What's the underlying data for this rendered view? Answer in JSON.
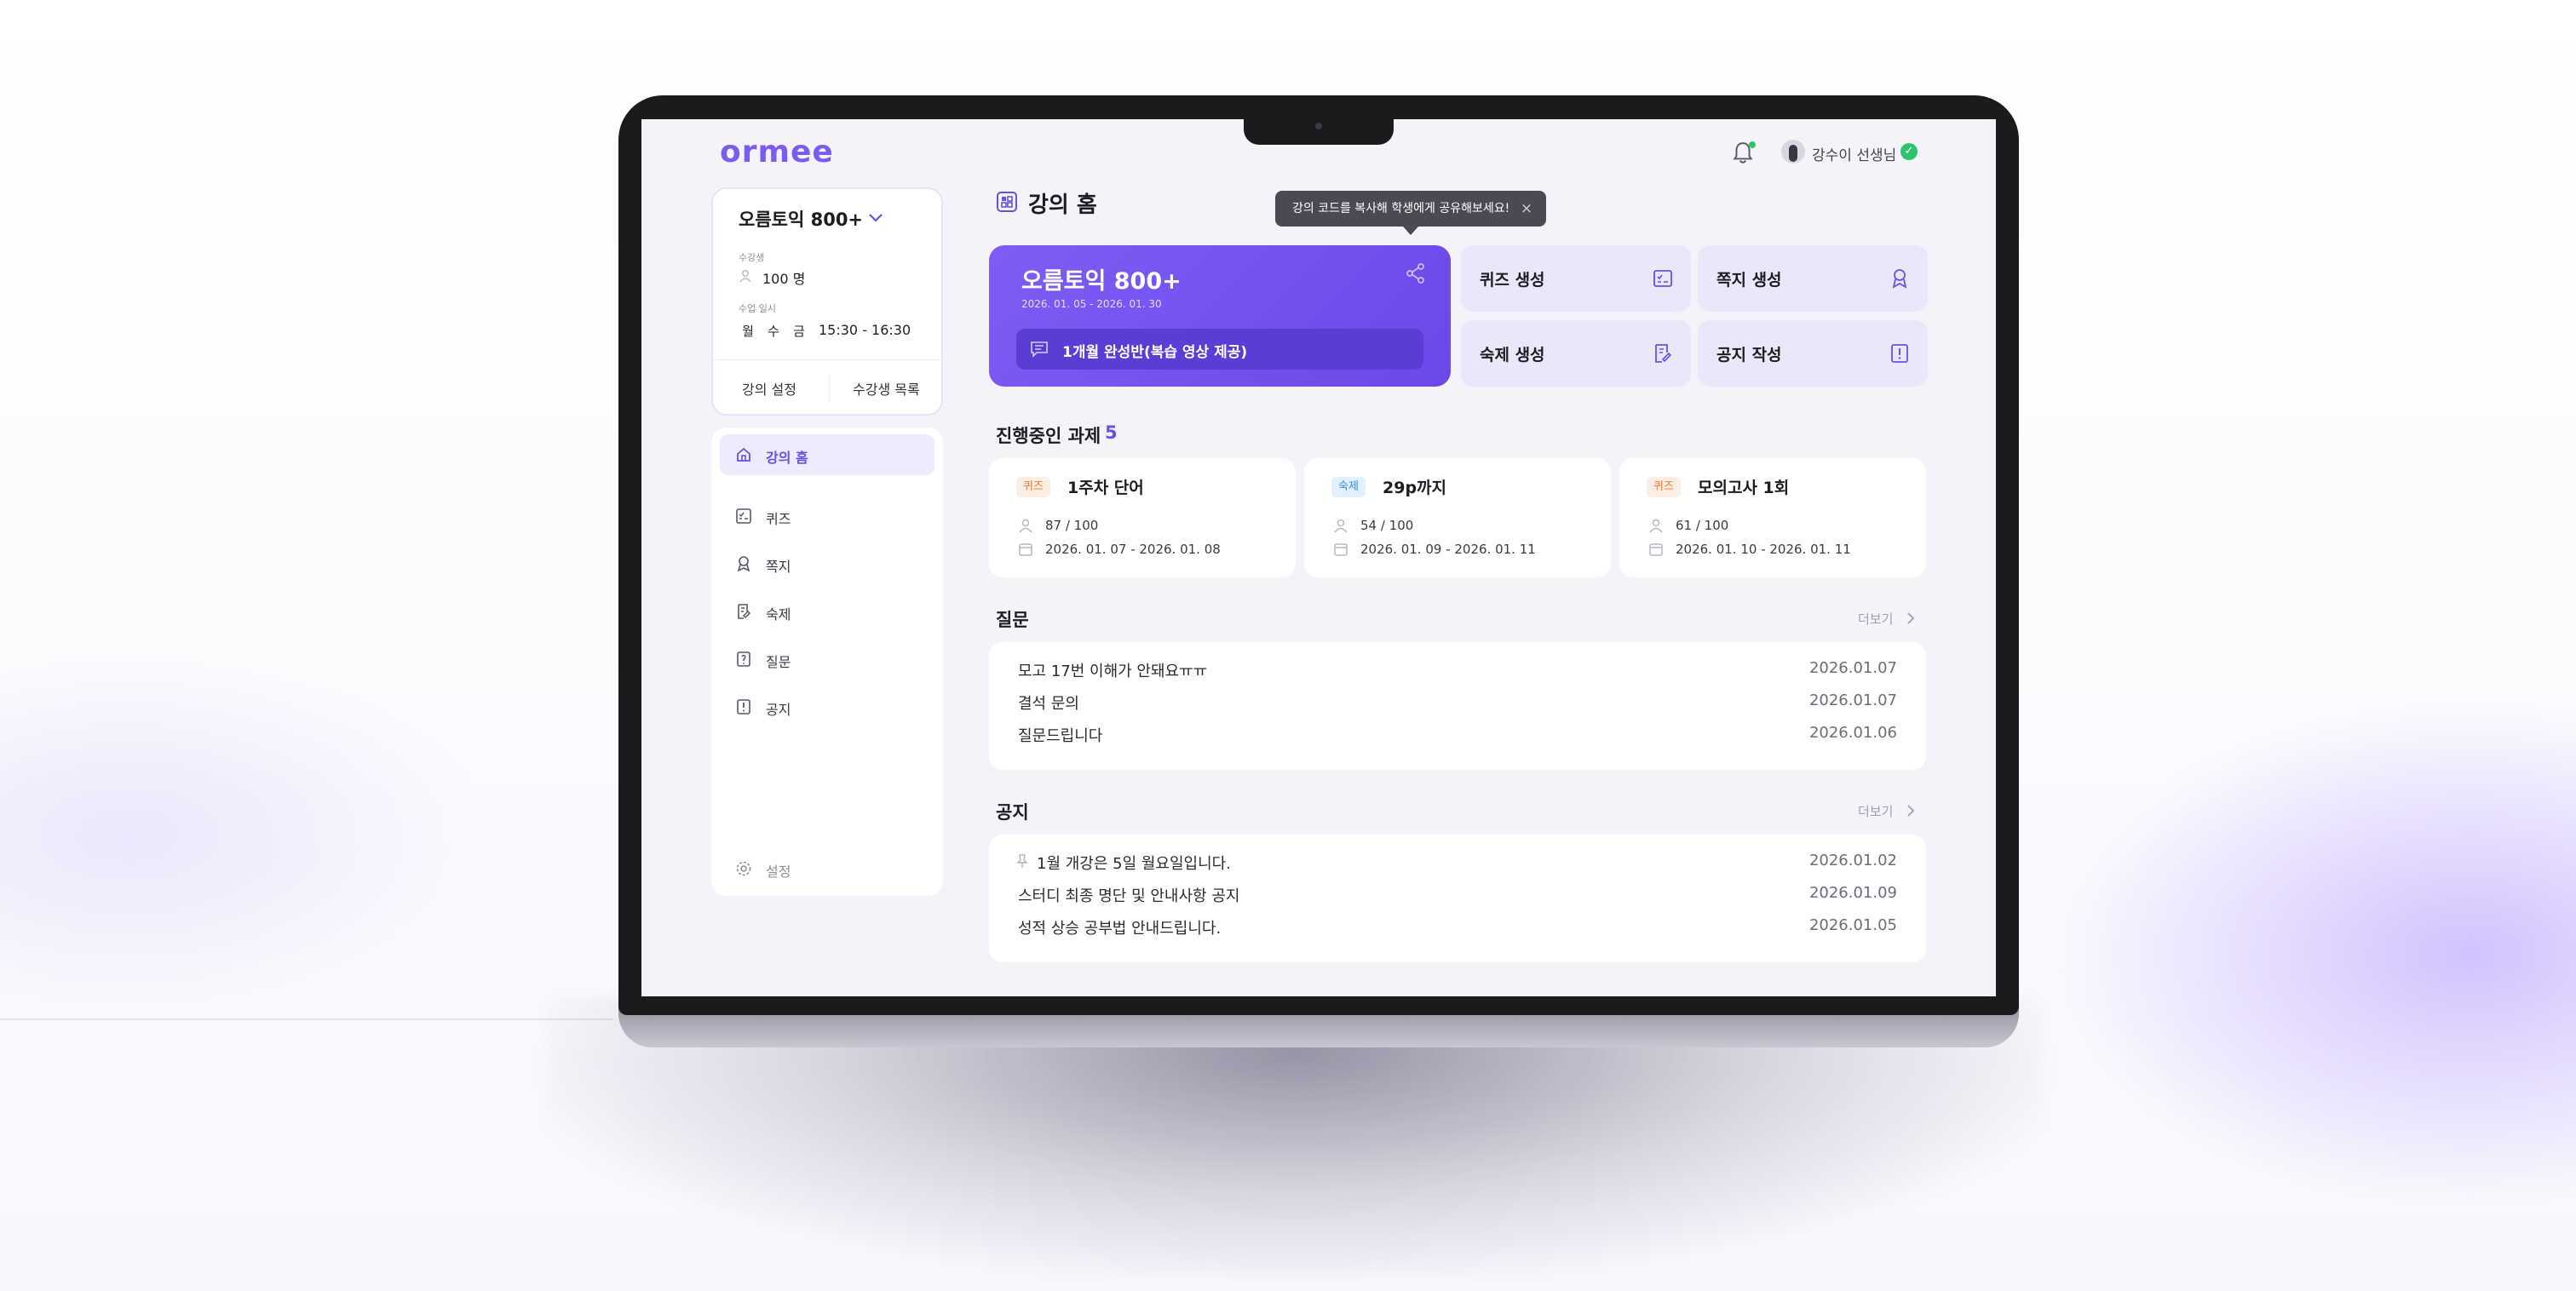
{
  "header": {
    "logo": "ormee",
    "teacher_name": "강수이 선생님"
  },
  "class_card": {
    "name": "오름토익 800+",
    "students_label": "수강생",
    "students_value": "100 명",
    "schedule_label": "수업 일시",
    "days": [
      "월",
      "수",
      "금"
    ],
    "time": "15:30 - 16:30",
    "settings_button": "강의 설정",
    "students_button": "수강생 목록"
  },
  "sidebar": {
    "items": [
      {
        "label": "강의 홈",
        "icon": "home-icon"
      },
      {
        "label": "퀴즈",
        "icon": "quiz-icon"
      },
      {
        "label": "쪽지",
        "icon": "note-icon"
      },
      {
        "label": "숙제",
        "icon": "homework-icon"
      },
      {
        "label": "질문",
        "icon": "question-icon"
      },
      {
        "label": "공지",
        "icon": "notice-icon"
      }
    ],
    "settings_label": "설정"
  },
  "page": {
    "title": "강의 홈"
  },
  "tooltip": {
    "text": "강의 코드를 복사해 학생에게 공유해보세요!",
    "close": "×"
  },
  "hero": {
    "title": "오름토익 800+",
    "dates": "2026. 01. 05 - 2026. 01. 30",
    "subtitle": "1개월 완성반(복습 영상 제공)"
  },
  "quick_actions": [
    {
      "label": "퀴즈 생성",
      "icon": "quiz-icon"
    },
    {
      "label": "쪽지 생성",
      "icon": "note-icon"
    },
    {
      "label": "숙제 생성",
      "icon": "homework-icon"
    },
    {
      "label": "공지 작성",
      "icon": "notice-icon"
    }
  ],
  "tasks_section": {
    "title": "진행중인 과제",
    "count": "5",
    "tasks": [
      {
        "badge": "퀴즈",
        "title": "1주차 단어",
        "progress": "87 / 100",
        "period": "2026. 01. 07 - 2026. 01. 08"
      },
      {
        "badge": "숙제",
        "title": "29p까지",
        "progress": "54 / 100",
        "period": "2026. 01. 09 - 2026. 01. 11"
      },
      {
        "badge": "퀴즈",
        "title": "모의고사 1회",
        "progress": "61 / 100",
        "period": "2026. 01. 10 - 2026. 01. 11"
      }
    ]
  },
  "questions": {
    "title": "질문",
    "more": "더보기",
    "rows": [
      {
        "text": "모고 17번 이해가 안돼요ㅠㅠ",
        "date": "2026.01.07"
      },
      {
        "text": "결석 문의",
        "date": "2026.01.07"
      },
      {
        "text": "질문드립니다",
        "date": "2026.01.06"
      }
    ]
  },
  "notices": {
    "title": "공지",
    "more": "더보기",
    "rows": [
      {
        "text": "1월 개강은 5일 월요일입니다.",
        "date": "2026.01.02",
        "pinned": true
      },
      {
        "text": "스터디 최종 명단 및 안내사항 공지",
        "date": "2026.01.09"
      },
      {
        "text": "성적 상승 공부법 안내드립니다.",
        "date": "2026.01.05"
      }
    ]
  },
  "colors": {
    "accent": "#6a4fe8",
    "hero": "#7b5cf3",
    "quiz_badge": "#f07a2a",
    "homework_badge": "#3c8be0",
    "verified": "#2ec46b"
  }
}
